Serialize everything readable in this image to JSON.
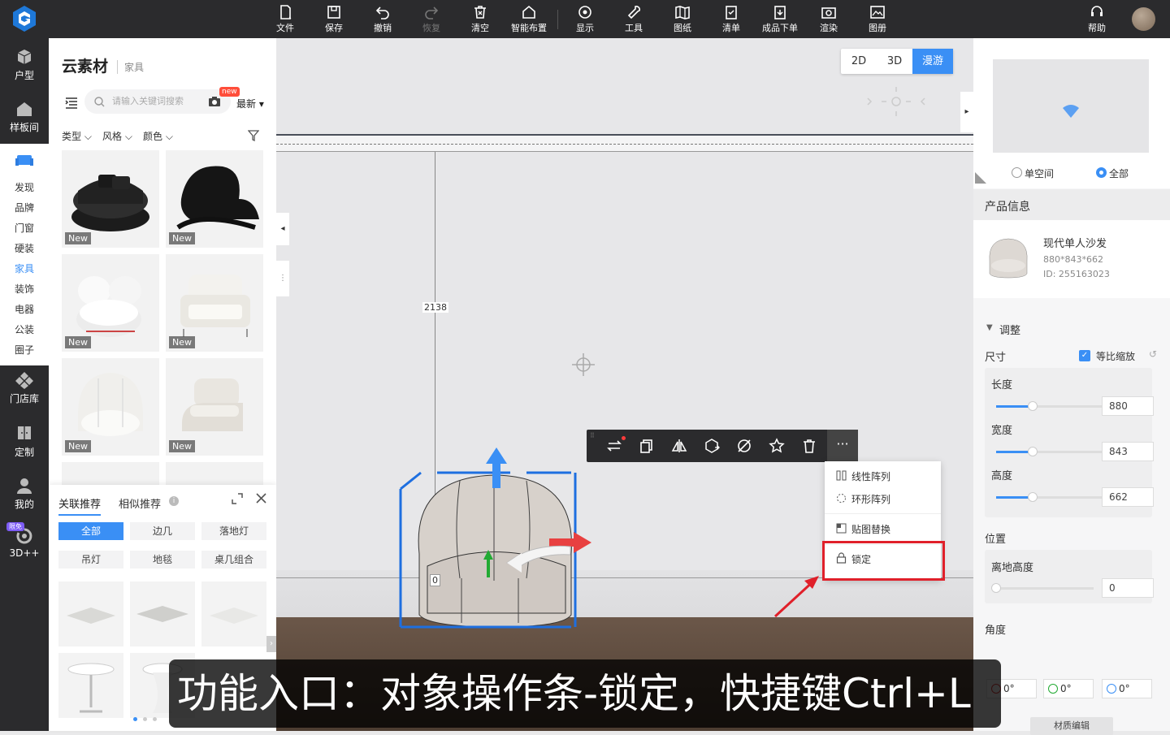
{
  "topbar": {
    "tools": [
      {
        "label": "文件",
        "icon": "file-icon"
      },
      {
        "label": "保存",
        "icon": "save-icon"
      },
      {
        "label": "撤销",
        "icon": "undo-icon"
      },
      {
        "label": "恢复",
        "icon": "redo-icon"
      },
      {
        "label": "清空",
        "icon": "clear-icon"
      },
      {
        "label": "智能布置",
        "icon": "smart-layout-icon"
      },
      {
        "label": "显示",
        "icon": "display-icon"
      },
      {
        "label": "工具",
        "icon": "wrench-icon"
      },
      {
        "label": "图纸",
        "icon": "drawing-icon"
      },
      {
        "label": "清单",
        "icon": "checklist-icon"
      },
      {
        "label": "成品下单",
        "icon": "order-icon"
      },
      {
        "label": "渲染",
        "icon": "camera-icon"
      },
      {
        "label": "图册",
        "icon": "album-icon"
      }
    ],
    "help": "帮助"
  },
  "leftnav": {
    "top": [
      {
        "label": "户型"
      },
      {
        "label": "样板间"
      }
    ],
    "sub": [
      "发现",
      "品牌",
      "门窗",
      "硬装",
      "家具",
      "装饰",
      "电器",
      "公装",
      "圈子"
    ],
    "active_sub": "家具",
    "bottom": [
      {
        "label": "门店库"
      },
      {
        "label": "定制"
      },
      {
        "label": "我的"
      },
      {
        "label": "3D++",
        "badge": "限免"
      }
    ]
  },
  "panel": {
    "title": "云素材",
    "subtitle": "家具",
    "search_placeholder": "请输入关键词搜索",
    "new_badge": "new",
    "sort": "最新",
    "filters": [
      "类型",
      "风格",
      "颜色"
    ],
    "new_label": "New",
    "tabs": [
      "关联推荐",
      "相似推荐"
    ],
    "chips": [
      "全部",
      "边几",
      "落地灯",
      "吊灯",
      "地毯",
      "桌几组合"
    ]
  },
  "scene": {
    "view_modes": [
      "2D",
      "3D",
      "漫游"
    ],
    "active_view": "漫游",
    "dimension": "2138",
    "height_label": "0",
    "menu_items": [
      "线性阵列",
      "环形阵列",
      "贴图替换",
      "锁定"
    ]
  },
  "right": {
    "room_options": [
      "单空间",
      "全部"
    ],
    "selected_room": "全部",
    "section_title": "产品信息",
    "product": {
      "name": "现代单人沙发",
      "size": "880*843*662",
      "id": "ID:  255163023"
    },
    "adjust": "调整",
    "size_label": "尺寸",
    "proportional": "等比缩放",
    "dims": [
      {
        "label": "长度",
        "value": "880",
        "pct": 0.3
      },
      {
        "label": "宽度",
        "value": "843",
        "pct": 0.3
      },
      {
        "label": "高度",
        "value": "662",
        "pct": 0.3
      }
    ],
    "position_label": "位置",
    "floor_height_label": "离地高度",
    "floor_height": "0",
    "angle_label": "角度",
    "angles": [
      "0°",
      "0°",
      "0°"
    ],
    "bottom_btn": "材质编辑"
  },
  "caption": "功能入口：对象操作条-锁定，快捷键Ctrl+L"
}
